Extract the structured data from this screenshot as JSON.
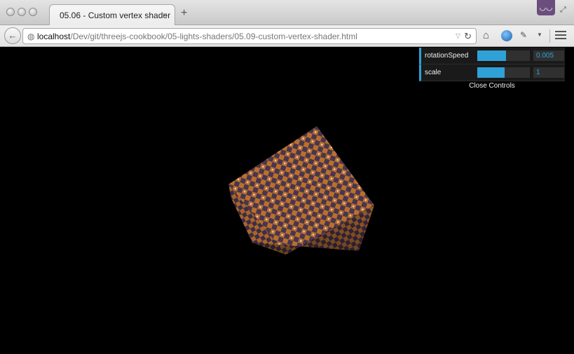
{
  "window": {
    "tab_title": "05.06 - Custom vertex shader",
    "tab_close": "×",
    "new_tab": "+"
  },
  "navbar": {
    "back_glyph": "←",
    "url_host": "localhost",
    "url_path": "/Dev/git/threejs-cookbook/05-lights-shaders/05.09-custom-vertex-shader.html",
    "reload_glyph": "↻"
  },
  "gui": {
    "controls": [
      {
        "label": "rotationSpeed",
        "value": "0.005",
        "fill_fraction": 0.55
      },
      {
        "label": "scale",
        "value": "1",
        "fill_fraction": 0.52
      }
    ],
    "close_label": "Close Controls"
  },
  "colors": {
    "accent": "#2fa1d6",
    "cube_orange": "#b8702a",
    "cube_purple": "#4a3550"
  }
}
